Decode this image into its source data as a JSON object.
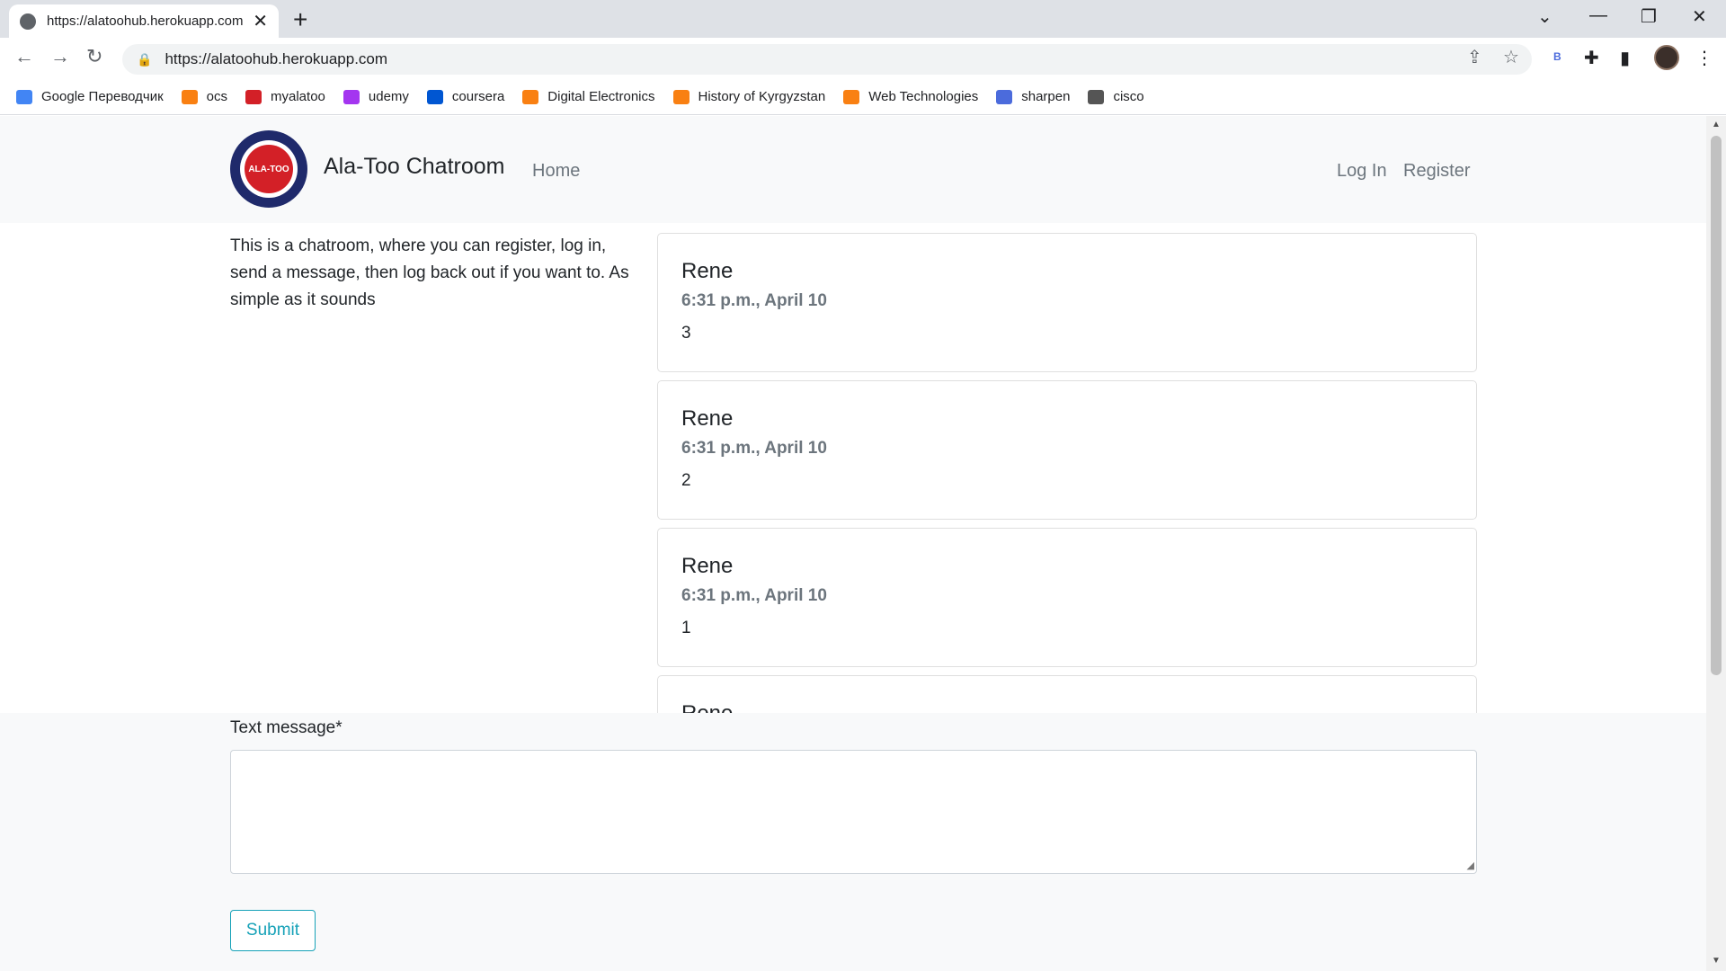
{
  "browser": {
    "tab_title": "https://alatoohub.herokuapp.com",
    "new_tab": "+",
    "url": "https://alatoohub.herokuapp.com",
    "bookmarks": [
      {
        "label": "Google Переводчик",
        "icon": "google-translate-icon",
        "color": "#4285f4"
      },
      {
        "label": "ocs",
        "icon": "moodle-icon",
        "color": "#f98012"
      },
      {
        "label": "myalatoo",
        "icon": "myalatoo-icon",
        "color": "#d32027"
      },
      {
        "label": "udemy",
        "icon": "udemy-icon",
        "color": "#a435f0"
      },
      {
        "label": "coursera",
        "icon": "coursera-icon",
        "color": "#0056d2"
      },
      {
        "label": "Digital Electronics",
        "icon": "moodle-icon",
        "color": "#f98012"
      },
      {
        "label": "History of Kyrgyzstan",
        "icon": "moodle-icon",
        "color": "#f98012"
      },
      {
        "label": "Web Technologies",
        "icon": "moodle-icon",
        "color": "#f98012"
      },
      {
        "label": "sharpen",
        "icon": "sharpen-icon",
        "color": "#4b6bdc"
      },
      {
        "label": "cisco",
        "icon": "cisco-icon",
        "color": "#555555"
      }
    ],
    "extension_letter": "B"
  },
  "site": {
    "brand": "Ala-Too Chatroom",
    "logo_text": "ALA-TOO",
    "nav": {
      "home": "Home",
      "login": "Log In",
      "register": "Register"
    },
    "intro": "This is a chatroom, where you can register, log in, send a message, then log back out if you want to. As simple as it sounds"
  },
  "messages": [
    {
      "author": "Rene",
      "time": "6:31 p.m., April 10",
      "body": "3"
    },
    {
      "author": "Rene",
      "time": "6:31 p.m., April 10",
      "body": "2"
    },
    {
      "author": "Rene",
      "time": "6:31 p.m., April 10",
      "body": "1"
    },
    {
      "author": "Rene",
      "time": "",
      "body": ""
    }
  ],
  "form": {
    "label": "Text message*",
    "value": "",
    "submit": "Submit"
  },
  "colors": {
    "accent": "#17a2b8",
    "navbar_bg": "#f8f9fa",
    "muted": "#6c757d"
  }
}
